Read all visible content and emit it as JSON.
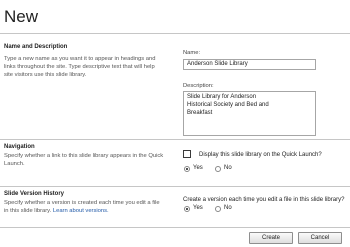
{
  "page": {
    "title": "New"
  },
  "name_section": {
    "heading": "Name and Description",
    "desc_lines": [
      "Type a new name as you want it to appear in headings and",
      "links throughout the site. Type descriptive text that will help",
      "site visitors use this slide library."
    ],
    "name_label": "Name:",
    "name_value": "Anderson Slide Library",
    "desc_label": "Description:",
    "desc_value_lines": [
      "Slide Library for Anderson",
      "Historical Society and Bed and",
      "Breakfast"
    ]
  },
  "navigation": {
    "heading": "Navigation",
    "desc_lines": [
      "Specify whether a link to this slide library appears in the Quick",
      "Launch."
    ],
    "question": "Display this slide library on the Quick Launch?",
    "options": [
      "Yes",
      "No"
    ],
    "selected": "Yes"
  },
  "version": {
    "heading": "Slide Version History",
    "desc_lines": [
      "Specify whether a version is created each time you edit a file",
      "in this slide library."
    ],
    "learn_more": "Learn about versions.",
    "question": "Create a version each time you edit a file in this slide library?",
    "options": [
      "Yes",
      "No"
    ],
    "selected": "Yes"
  },
  "buttons": {
    "create": "Create",
    "cancel": "Cancel"
  }
}
